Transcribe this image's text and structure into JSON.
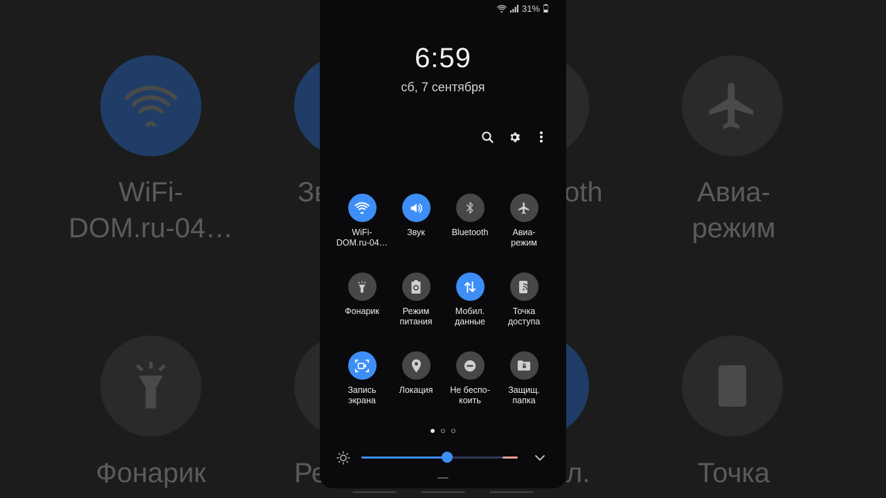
{
  "status_bar": {
    "battery": "31%",
    "wifi_icon": "wifi-icon",
    "signal_icon": "signal-icon",
    "battery_icon": "battery-icon"
  },
  "clock": {
    "time": "6:59",
    "date": "сб, 7 сентября"
  },
  "toolbar": {
    "search_icon": "search-icon",
    "settings_icon": "gear-icon",
    "more_icon": "more-vertical-icon"
  },
  "tiles": [
    {
      "label_1": "WiFi-",
      "label_2": "DOM.ru-04…",
      "icon": "wifi-icon",
      "active": true
    },
    {
      "label_1": "Звук",
      "label_2": "",
      "icon": "speaker-icon",
      "active": true
    },
    {
      "label_1": "Bluetooth",
      "label_2": "",
      "icon": "bluetooth-icon",
      "active": false
    },
    {
      "label_1": "Авиа-",
      "label_2": "режим",
      "icon": "airplane-icon",
      "active": false
    },
    {
      "label_1": "Фонарик",
      "label_2": "",
      "icon": "flashlight-icon",
      "active": false
    },
    {
      "label_1": "Режим",
      "label_2": "питания",
      "icon": "battery-mode-icon",
      "active": false
    },
    {
      "label_1": "Мобил.",
      "label_2": "данные",
      "icon": "mobile-data-icon",
      "active": true
    },
    {
      "label_1": "Точка",
      "label_2": "доступа",
      "icon": "hotspot-icon",
      "active": false
    },
    {
      "label_1": "Запись",
      "label_2": "экрана",
      "icon": "screen-record-icon",
      "active": true
    },
    {
      "label_1": "Локация",
      "label_2": "",
      "icon": "location-icon",
      "active": false
    },
    {
      "label_1": "Не беспо-",
      "label_2": "коить",
      "icon": "do-not-disturb-icon",
      "active": false
    },
    {
      "label_1": "Защищ.",
      "label_2": "папка",
      "icon": "secure-folder-icon",
      "active": false
    }
  ],
  "page_indicator": {
    "pages": 3,
    "current": 1
  },
  "brightness": {
    "level": 0.55,
    "icon": "sun-icon",
    "expand_icon": "chevron-down-icon"
  },
  "background": {
    "labels": [
      "WiFi-\nDOM.ru-04…",
      "Авиа-\nрежим",
      "Фонарик",
      "Точка",
      "Зв",
      "oth",
      "Ре",
      "л."
    ]
  },
  "colors": {
    "accent": "#3d8ef6",
    "tile_off": "#474749",
    "panel": "#0a0a0c"
  }
}
